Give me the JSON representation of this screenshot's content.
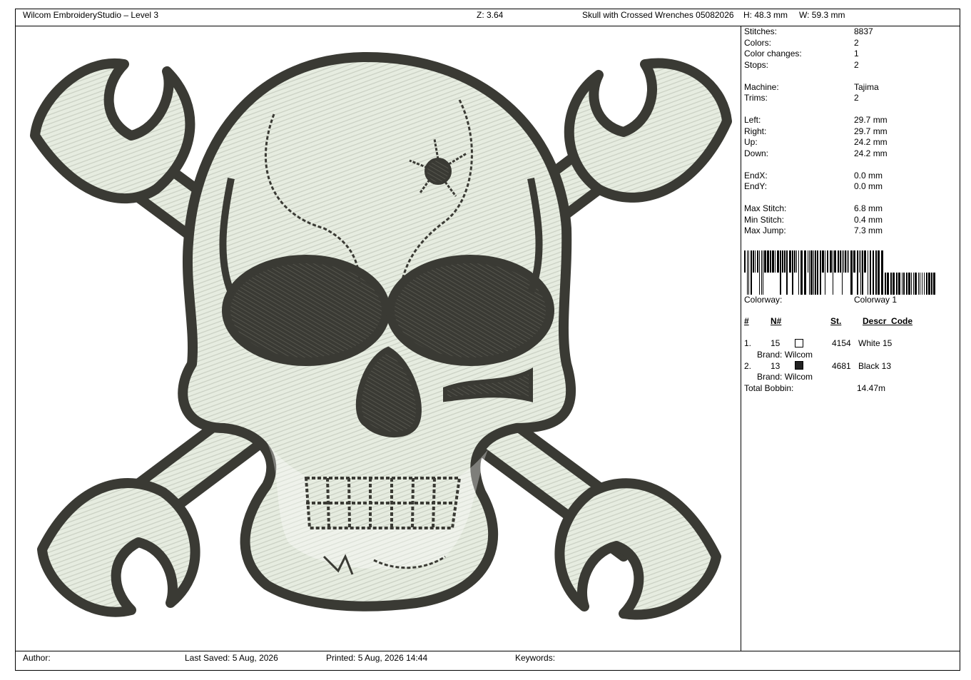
{
  "header": {
    "app_title": "Wilcom EmbroideryStudio – Level 3",
    "zoom": "Z: 3.64",
    "design_name": "Skull with Crossed Wrenches 05082026",
    "height": "H: 48.3 mm",
    "width": "W: 59.3 mm"
  },
  "stats": [
    {
      "label": "Stitches:",
      "value": "8837"
    },
    {
      "label": "Colors:",
      "value": "2"
    },
    {
      "label": "Color changes:",
      "value": "1"
    },
    {
      "label": "Stops:",
      "value": "2"
    },
    {
      "label": "Machine:",
      "value": "Tajima"
    },
    {
      "label": "Trims:",
      "value": "2"
    },
    {
      "label": "Left:",
      "value": "29.7 mm"
    },
    {
      "label": "Right:",
      "value": "29.7 mm"
    },
    {
      "label": "Up:",
      "value": "24.2 mm"
    },
    {
      "label": "Down:",
      "value": "24.2 mm"
    },
    {
      "label": "EndX:",
      "value": "0.0 mm"
    },
    {
      "label": "EndY:",
      "value": "0.0 mm"
    },
    {
      "label": "Max Stitch:",
      "value": "6.8 mm"
    },
    {
      "label": "Min Stitch:",
      "value": "0.4 mm"
    },
    {
      "label": "Max Jump:",
      "value": "7.3 mm"
    }
  ],
  "colorway": {
    "label": "Colorway:",
    "value": "Colorway 1"
  },
  "color_table": {
    "headers": {
      "num": "#",
      "needle": "N#",
      "stitches": "St.",
      "descr": "Descr_Code"
    },
    "rows": [
      {
        "index": "1.",
        "needle": "15",
        "swatch_color": "#ffffff",
        "stitches": "4154",
        "descr": "White 15",
        "brand": "Brand: Wilcom"
      },
      {
        "index": "2.",
        "needle": "13",
        "swatch_color": "#222222",
        "stitches": "4681",
        "descr": "Black 13",
        "brand": "Brand: Wilcom"
      }
    ],
    "total_bobbin_label": "Total Bobbin:",
    "total_bobbin_value": "14.47m"
  },
  "footer": {
    "author": "Author:",
    "last_saved": "Last Saved:  5 Aug, 2026",
    "printed": "Printed:  5 Aug, 2026 14:44",
    "keywords": "Keywords:"
  },
  "colors": {
    "thread_light": "#e6ece0",
    "thread_dark": "#3a3a34",
    "thread_mid": "#c9cfc2"
  }
}
